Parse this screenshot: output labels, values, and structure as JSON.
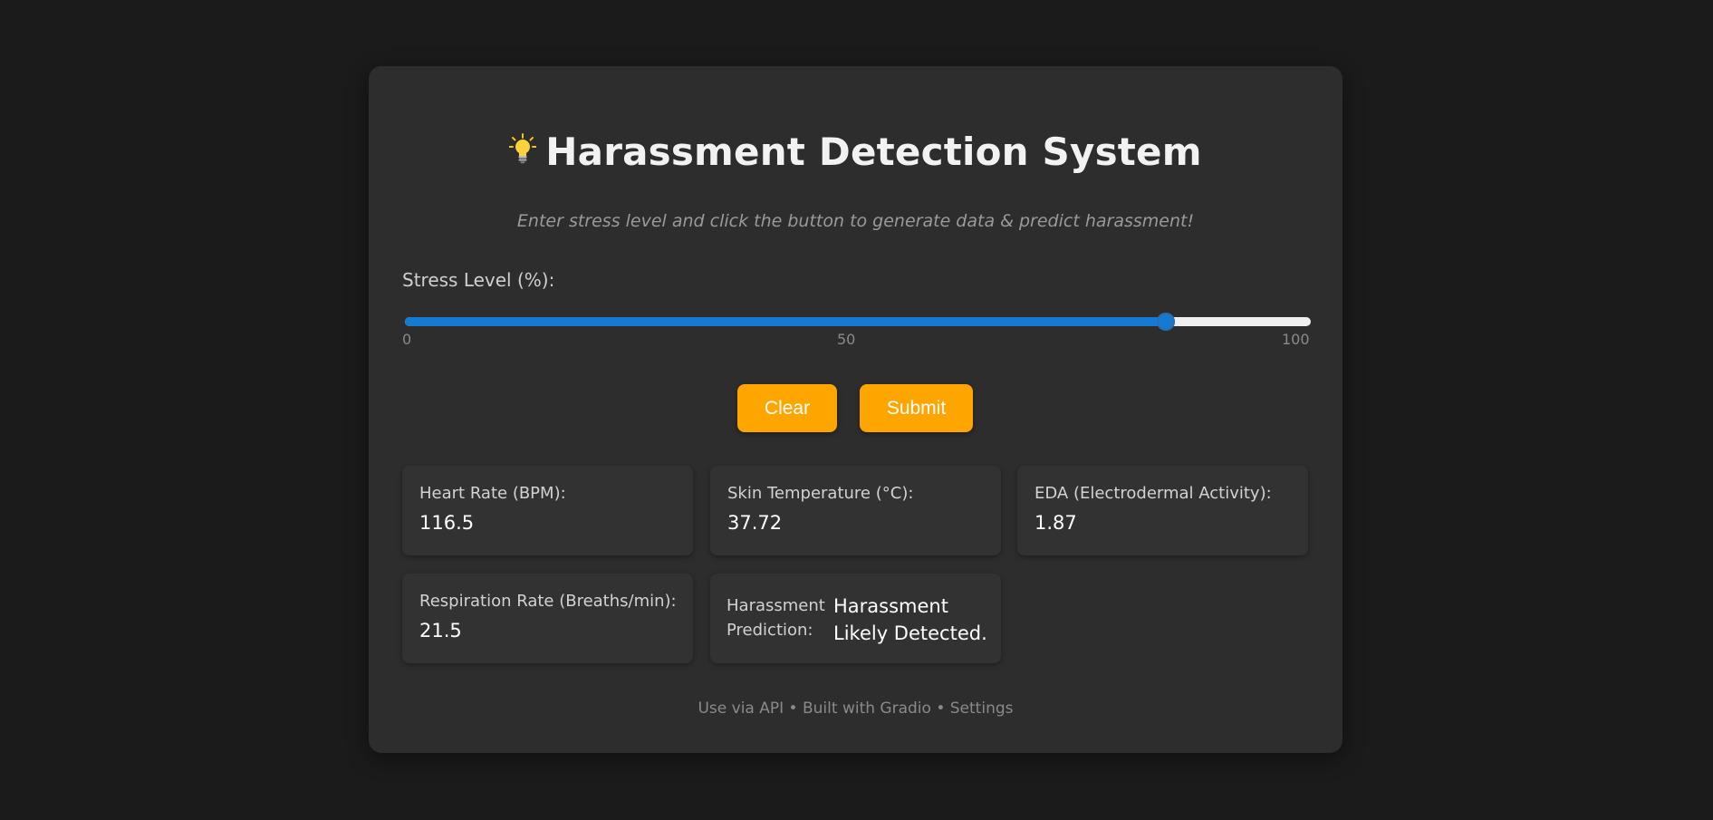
{
  "app": {
    "title": "Harassment Detection System",
    "title_icon": "lightbulb-icon",
    "subtitle": "Enter stress level and click the button to generate data & predict harassment!"
  },
  "stress": {
    "label": "Stress Level (%):",
    "value": 84,
    "min": 0,
    "max": 100,
    "ticks": [
      "0",
      "50",
      "100"
    ]
  },
  "buttons": {
    "clear_label": "Clear",
    "submit_label": "Submit"
  },
  "outputs": {
    "heart_rate": {
      "label": "Heart Rate (BPM):",
      "value": "116.5"
    },
    "skin_temperature": {
      "label": "Skin Temperature (°C):",
      "value": "37.72"
    },
    "eda": {
      "label": "EDA (Electrodermal Activity):",
      "value": "1.87"
    },
    "respiration_rate": {
      "label": "Respiration Rate (Breaths/min):",
      "value": "21.5"
    },
    "prediction": {
      "label": "Harassment Prediction:",
      "value": "Harassment Likely Detected."
    }
  },
  "footer": {
    "api_link": "Use via API",
    "separator": " • ",
    "built_with": "Built with Gradio",
    "settings_link": "Settings"
  },
  "colors": {
    "page_background": "#1b1b1b",
    "card_background": "#2d2d2d",
    "accent_button": "#ffa500",
    "slider_fill": "#1679d2",
    "slider_track": "#f0f0f0"
  }
}
